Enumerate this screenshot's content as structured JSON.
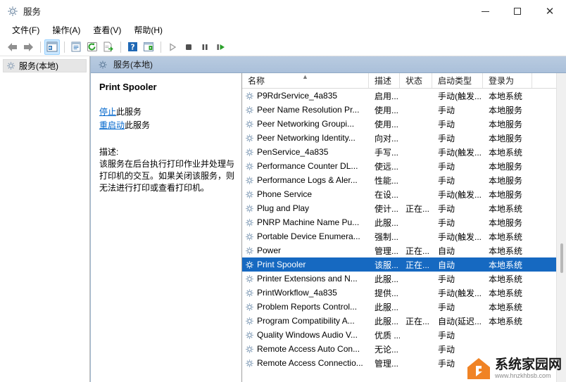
{
  "window": {
    "title": "服务",
    "icon": "services-gear-icon",
    "minimize_label": "最小化",
    "maximize_label": "最大化",
    "close_label": "关闭"
  },
  "menu": {
    "items": [
      {
        "label": "文件(F)",
        "name": "menu-file"
      },
      {
        "label": "操作(A)",
        "name": "menu-action"
      },
      {
        "label": "查看(V)",
        "name": "menu-view"
      },
      {
        "label": "帮助(H)",
        "name": "menu-help"
      }
    ]
  },
  "toolbar": {
    "buttons": [
      {
        "name": "back-icon",
        "glyph": "back"
      },
      {
        "name": "forward-icon",
        "glyph": "forward"
      },
      {
        "name": "show-hide-console-tree-icon",
        "glyph": "tree",
        "active": true
      },
      {
        "name": "properties-icon",
        "glyph": "properties"
      },
      {
        "name": "refresh-icon",
        "glyph": "refresh"
      },
      {
        "name": "export-list-icon",
        "glyph": "export"
      },
      {
        "name": "help-icon",
        "glyph": "help"
      },
      {
        "name": "show-hide-action-pane-icon",
        "glyph": "actionpane"
      },
      {
        "name": "start-service-icon",
        "glyph": "play"
      },
      {
        "name": "stop-service-icon",
        "glyph": "stop"
      },
      {
        "name": "pause-service-icon",
        "glyph": "pause"
      },
      {
        "name": "restart-service-icon",
        "glyph": "restart"
      }
    ]
  },
  "tree": {
    "node_label": "服务(本地)"
  },
  "pane": {
    "header": "服务(本地)"
  },
  "details": {
    "service_name": "Print Spooler",
    "stop_link": "停止",
    "stop_suffix": "此服务",
    "restart_link": "重启动",
    "restart_suffix": "此服务",
    "description_label": "描述:",
    "description_lines": [
      "该服务在后台执行打印作业并处理与",
      "打印机的交互。如果关闭该服务，则",
      "无法进行打印或查看打印机。"
    ]
  },
  "list": {
    "columns": [
      {
        "key": "name",
        "label": "名称",
        "sorted": true,
        "sort_dir": "asc"
      },
      {
        "key": "desc",
        "label": "描述"
      },
      {
        "key": "state",
        "label": "状态"
      },
      {
        "key": "start",
        "label": "启动类型"
      },
      {
        "key": "logon",
        "label": "登录为"
      }
    ],
    "rows": [
      {
        "name": "P9RdrService_4a835",
        "desc": "启用...",
        "state": "",
        "start": "手动(触发...",
        "logon": "本地系统",
        "selected": false
      },
      {
        "name": "Peer Name Resolution Pr...",
        "desc": "使用...",
        "state": "",
        "start": "手动",
        "logon": "本地服务",
        "selected": false
      },
      {
        "name": "Peer Networking Groupi...",
        "desc": "使用...",
        "state": "",
        "start": "手动",
        "logon": "本地服务",
        "selected": false
      },
      {
        "name": "Peer Networking Identity...",
        "desc": "向对...",
        "state": "",
        "start": "手动",
        "logon": "本地服务",
        "selected": false
      },
      {
        "name": "PenService_4a835",
        "desc": "手写...",
        "state": "",
        "start": "手动(触发...",
        "logon": "本地系统",
        "selected": false
      },
      {
        "name": "Performance Counter DL...",
        "desc": "使远...",
        "state": "",
        "start": "手动",
        "logon": "本地服务",
        "selected": false
      },
      {
        "name": "Performance Logs & Aler...",
        "desc": "性能...",
        "state": "",
        "start": "手动",
        "logon": "本地服务",
        "selected": false
      },
      {
        "name": "Phone Service",
        "desc": "在设...",
        "state": "",
        "start": "手动(触发...",
        "logon": "本地服务",
        "selected": false
      },
      {
        "name": "Plug and Play",
        "desc": "使计...",
        "state": "正在...",
        "start": "手动",
        "logon": "本地系统",
        "selected": false
      },
      {
        "name": "PNRP Machine Name Pu...",
        "desc": "此服...",
        "state": "",
        "start": "手动",
        "logon": "本地服务",
        "selected": false
      },
      {
        "name": "Portable Device Enumera...",
        "desc": "强制...",
        "state": "",
        "start": "手动(触发...",
        "logon": "本地系统",
        "selected": false
      },
      {
        "name": "Power",
        "desc": "管理...",
        "state": "正在...",
        "start": "自动",
        "logon": "本地系统",
        "selected": false
      },
      {
        "name": "Print Spooler",
        "desc": "该服...",
        "state": "正在...",
        "start": "自动",
        "logon": "本地系统",
        "selected": true
      },
      {
        "name": "Printer Extensions and N...",
        "desc": "此服...",
        "state": "",
        "start": "手动",
        "logon": "本地系统",
        "selected": false
      },
      {
        "name": "PrintWorkflow_4a835",
        "desc": "提供...",
        "state": "",
        "start": "手动(触发...",
        "logon": "本地系统",
        "selected": false
      },
      {
        "name": "Problem Reports Control...",
        "desc": "此服...",
        "state": "",
        "start": "手动",
        "logon": "本地系统",
        "selected": false
      },
      {
        "name": "Program Compatibility A...",
        "desc": "此服...",
        "state": "正在...",
        "start": "自动(延迟...",
        "logon": "本地系统",
        "selected": false
      },
      {
        "name": "Quality Windows Audio V...",
        "desc": "优质 ...",
        "state": "",
        "start": "手动",
        "logon": "",
        "selected": false
      },
      {
        "name": "Remote Access Auto Con...",
        "desc": "无论...",
        "state": "",
        "start": "手动",
        "logon": "",
        "selected": false
      },
      {
        "name": "Remote Access Connectio...",
        "desc": "管理...",
        "state": "",
        "start": "手动",
        "logon": "",
        "selected": false
      }
    ]
  },
  "watermark": {
    "name_cn": "系统家园网",
    "url": "www.hnzkhbsb.com",
    "logo_color": "#f08325"
  },
  "colors": {
    "selection": "#1669c1",
    "link": "#0066cc",
    "pane_header_top": "#b9cbe0",
    "pane_header_bottom": "#aac0da"
  }
}
